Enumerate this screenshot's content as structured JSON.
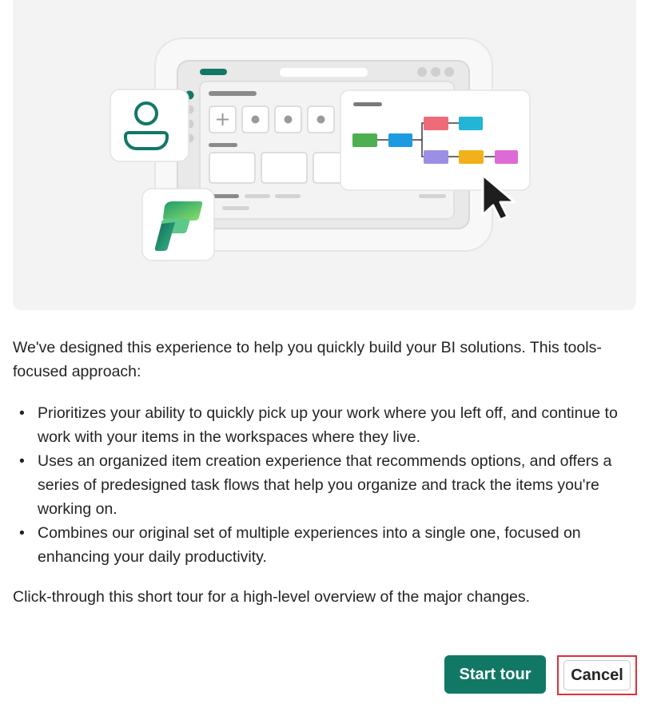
{
  "intro": "We've designed this experience to help you quickly build your BI solutions. This tools-focused approach:",
  "bullets": [
    "Prioritizes your ability to quickly pick up your work where you left off, and continue to work with your items in the workspaces where they live.",
    "Uses an organized item creation experience that recommends options, and offers a series of predesigned task flows that help you organize and track the items you're working on.",
    "Combines our original set of multiple experiences into a single one, focused on enhancing your daily productivity."
  ],
  "outro": "Click-through this short tour for a high-level overview of the major changes.",
  "buttons": {
    "start_label": "Start tour",
    "cancel_label": "Cancel"
  },
  "colors": {
    "primary": "#117865",
    "highlight": "#e0303a"
  },
  "illustration": {
    "icons": [
      "person-icon",
      "fabric-logo-icon",
      "plus-icon",
      "cursor-icon",
      "task-flow-diagram"
    ]
  }
}
